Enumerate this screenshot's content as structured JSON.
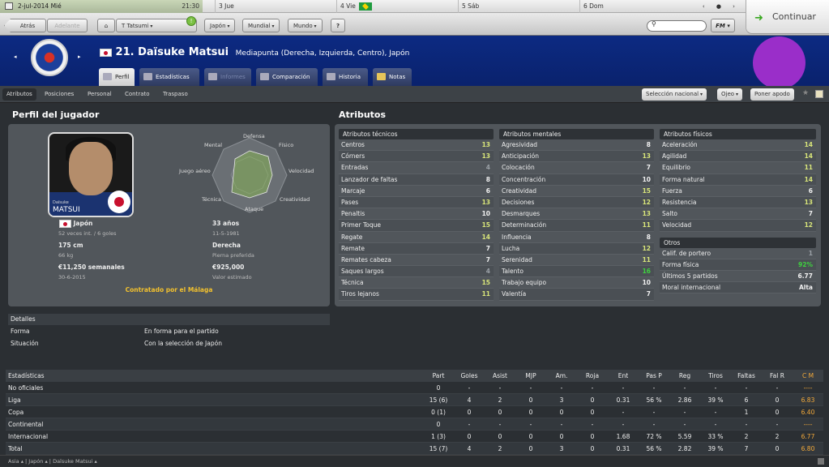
{
  "topbar": {
    "date": "2-jul-2014 Mié",
    "time": "21:30",
    "days": [
      "3 Jue",
      "4 Vie",
      "5 Sáb",
      "6 Dom"
    ],
    "nav_glyphs": "‹ ● ›",
    "continue_label": "Continuar"
  },
  "toolbar": {
    "back": "Atrás",
    "forward": "Adelante",
    "manager": "T Tatsumi",
    "japan": "Japón",
    "mundial": "Mundial",
    "mundo": "Mundo",
    "help": "?",
    "fm": "FM"
  },
  "header": {
    "player_name": "21. Daïsuke Matsui",
    "positions": "Mediapunta (Derecha, Izquierda, Centro), Japón",
    "tabs": [
      "Perfil",
      "Estadísticas",
      "Informes",
      "Comparación",
      "Historia",
      "Notas"
    ]
  },
  "subtabs": {
    "items": [
      "Atributos",
      "Posiciones",
      "Personal",
      "Contrato",
      "Traspaso"
    ],
    "seleccion": "Selección nacional",
    "ojeo": "Ojeo",
    "poner_apodo": "Poner apodo"
  },
  "profile": {
    "title": "Perfil del jugador",
    "photo_first": "Daïsuke",
    "photo_last": "MATSUI",
    "radar_labels": {
      "defensa": "Defensa",
      "fisico": "Físico",
      "velocidad": "Velocidad",
      "creatividad": "Creatividad",
      "ataque": "Ataque",
      "tecnica": "Técnica",
      "juego_aereo": "Juego aéreo",
      "mental": "Mental"
    },
    "nation": "Japón",
    "caps": "52 veces int. / 6 goles",
    "age": "33 años",
    "dob": "11-5-1981",
    "height": "175 cm",
    "weight": "66 kg",
    "foot": "Derecha",
    "foot_label": "Pierna preferida",
    "wage": "€11,250 semanales",
    "contract_end": "30-6-2015",
    "value": "€925,000",
    "value_label": "Valor estimado",
    "contract_status": "Contratado por el Málaga"
  },
  "attributes": {
    "title": "Atributos",
    "technical_title": "Atributos técnicos",
    "technical": [
      [
        "Centros",
        "13"
      ],
      [
        "Córners",
        "13"
      ],
      [
        "Entradas",
        "4"
      ],
      [
        "Lanzador de faltas",
        "8"
      ],
      [
        "Marcaje",
        "6"
      ],
      [
        "Pases",
        "13"
      ],
      [
        "Penaltis",
        "10"
      ],
      [
        "Primer Toque",
        "15"
      ],
      [
        "Regate",
        "14"
      ],
      [
        "Remate",
        "7"
      ],
      [
        "Remates cabeza",
        "7"
      ],
      [
        "Saques largos",
        "4"
      ],
      [
        "Técnica",
        "15"
      ],
      [
        "Tiros lejanos",
        "11"
      ]
    ],
    "mental_title": "Atributos mentales",
    "mental": [
      [
        "Agresividad",
        "8"
      ],
      [
        "Anticipación",
        "13"
      ],
      [
        "Colocación",
        "7"
      ],
      [
        "Concentración",
        "10"
      ],
      [
        "Creatividad",
        "15"
      ],
      [
        "Decisiones",
        "12"
      ],
      [
        "Desmarques",
        "13"
      ],
      [
        "Determinación",
        "11"
      ],
      [
        "Influencia",
        "8"
      ],
      [
        "Lucha",
        "12"
      ],
      [
        "Serenidad",
        "11"
      ],
      [
        "Talento",
        "16"
      ],
      [
        "Trabajo equipo",
        "10"
      ],
      [
        "Valentía",
        "7"
      ]
    ],
    "physical_title": "Atributos físicos",
    "physical": [
      [
        "Aceleración",
        "14"
      ],
      [
        "Agilidad",
        "14"
      ],
      [
        "Equilibrio",
        "11"
      ],
      [
        "Forma natural",
        "14"
      ],
      [
        "Fuerza",
        "6"
      ],
      [
        "Resistencia",
        "13"
      ],
      [
        "Salto",
        "7"
      ],
      [
        "Velocidad",
        "12"
      ]
    ],
    "other_title": "Otros",
    "other": [
      [
        "Calif. de portero",
        "1"
      ],
      [
        "Forma física",
        "92%"
      ],
      [
        "Últimos 5 partidos",
        "6.77"
      ],
      [
        "Moral internacional",
        "Alta"
      ]
    ]
  },
  "details": {
    "title": "Detalles",
    "rows": [
      [
        "Forma",
        "En forma para el partido"
      ],
      [
        "Situación",
        "Con la selección de Japón"
      ]
    ]
  },
  "stats": {
    "headers": [
      "Estadísticas",
      "Part",
      "Goles",
      "Asist",
      "MJP",
      "Am.",
      "Roja",
      "Ent",
      "Pas P",
      "Reg",
      "Tiros",
      "Faltas",
      "Fal R",
      "C M"
    ],
    "rows": [
      [
        "No oficiales",
        "0",
        "-",
        "-",
        "-",
        "-",
        "-",
        "-",
        "-",
        "-",
        "-",
        "-",
        "-",
        "----"
      ],
      [
        "Liga",
        "15 (6)",
        "4",
        "2",
        "0",
        "3",
        "0",
        "0.31",
        "56 %",
        "2.86",
        "39 %",
        "6",
        "0",
        "6.83"
      ],
      [
        "Copa",
        "0 (1)",
        "0",
        "0",
        "0",
        "0",
        "0",
        "-",
        "-",
        "-",
        "-",
        "1",
        "0",
        "6.40"
      ],
      [
        "Continental",
        "0",
        "-",
        "-",
        "-",
        "-",
        "-",
        "-",
        "-",
        "-",
        "-",
        "-",
        "-",
        "----"
      ],
      [
        "Internacional",
        "1 (3)",
        "0",
        "0",
        "0",
        "0",
        "0",
        "1.68",
        "72 %",
        "5.59",
        "33 %",
        "2",
        "2",
        "6.77"
      ],
      [
        "Total",
        "15 (7)",
        "4",
        "2",
        "0",
        "3",
        "0",
        "0.31",
        "56 %",
        "2.82",
        "39 %",
        "7",
        "0",
        "6.80"
      ]
    ]
  },
  "bottombar": {
    "crumbs": [
      "Asia",
      "Japón",
      "Daïsuke Matsui"
    ]
  },
  "colors": {
    "header_blue": "#0c2a82",
    "accent_yellow": "#f2c12e",
    "rating_orange": "#f2a93a",
    "purple_badge": "#9a2ec9"
  }
}
